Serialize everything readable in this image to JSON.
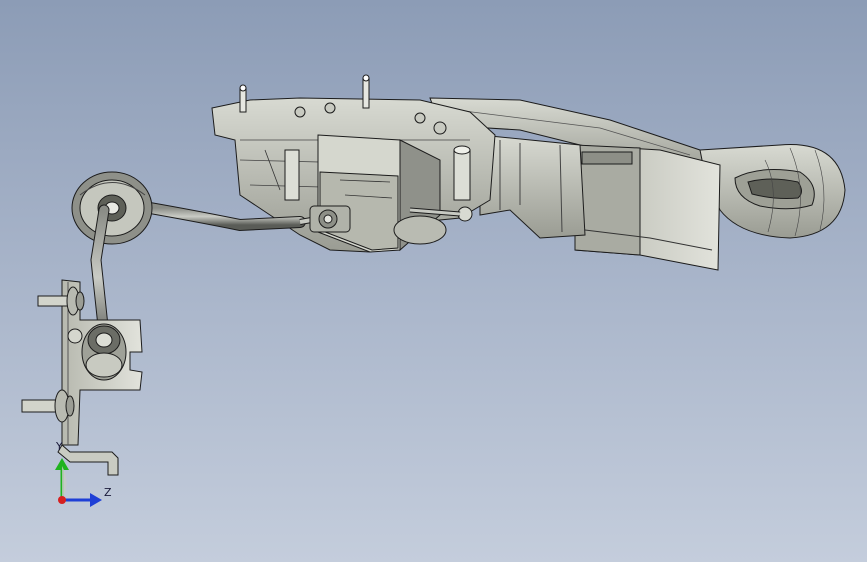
{
  "viewport": {
    "background_top": "#8c9cb6",
    "background_bottom": "#c4cddc",
    "model_shade": "#c3c5bc",
    "model_dark": "#6e7068",
    "edge_color": "#1c1c1c"
  },
  "triad": {
    "y_label": "Y",
    "z_label": "Z",
    "y_color": "#1fb31f",
    "z_color": "#1f3fd6",
    "x_color": "#d62020"
  },
  "icons": {
    "model": "cad-3d-model-icon",
    "triad": "axis-triad-icon"
  }
}
